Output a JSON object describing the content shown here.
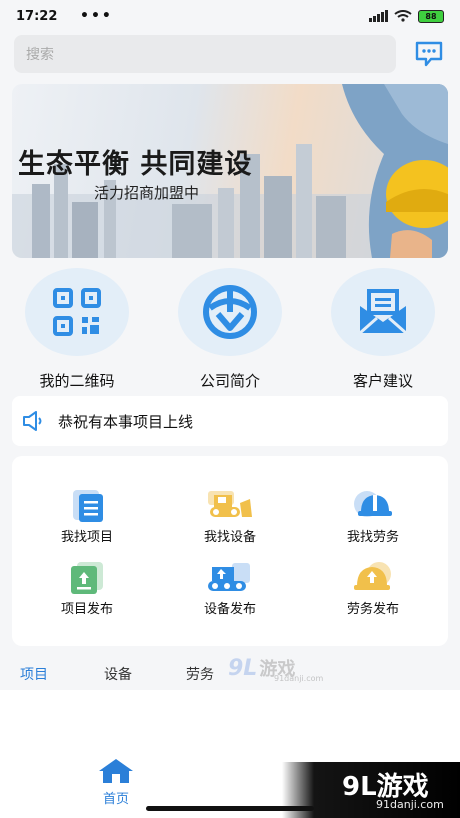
{
  "status_bar": {
    "time": "17:22",
    "dots": "•••",
    "battery": "88"
  },
  "search": {
    "placeholder": "搜索"
  },
  "banner": {
    "title": "生态平衡  共同建设",
    "subtitle": "活力招商加盟中"
  },
  "quick_links": [
    {
      "label": "我的二维码",
      "icon": "qrcode-icon"
    },
    {
      "label": "公司简介",
      "icon": "company-logo-icon"
    },
    {
      "label": "客户建议",
      "icon": "mail-icon"
    }
  ],
  "notice": {
    "text": "恭祝有本事项目上线"
  },
  "grid": [
    {
      "label": "我找项目",
      "icon": "document-icon"
    },
    {
      "label": "我找设备",
      "icon": "bulldozer-icon"
    },
    {
      "label": "我找劳务",
      "icon": "hardhat-icon"
    },
    {
      "label": "项目发布",
      "icon": "upload-doc-icon"
    },
    {
      "label": "设备发布",
      "icon": "excavator-icon"
    },
    {
      "label": "劳务发布",
      "icon": "hardhat-publish-icon"
    }
  ],
  "tabs": [
    {
      "label": "项目",
      "active": true
    },
    {
      "label": "设备",
      "active": false
    },
    {
      "label": "劳务",
      "active": false
    }
  ],
  "watermark_small": {
    "logo": "9L",
    "text": "游戏",
    "url": "91danji.com"
  },
  "bottom_nav": {
    "home_label": "首页"
  },
  "brand_watermark": {
    "text": "9L游戏",
    "url": "91danji.com"
  },
  "colors": {
    "accent": "#2b7fd8",
    "icon_blue": "#2f8de4",
    "icon_yellow": "#f1c04b",
    "icon_green": "#5fb97a"
  }
}
